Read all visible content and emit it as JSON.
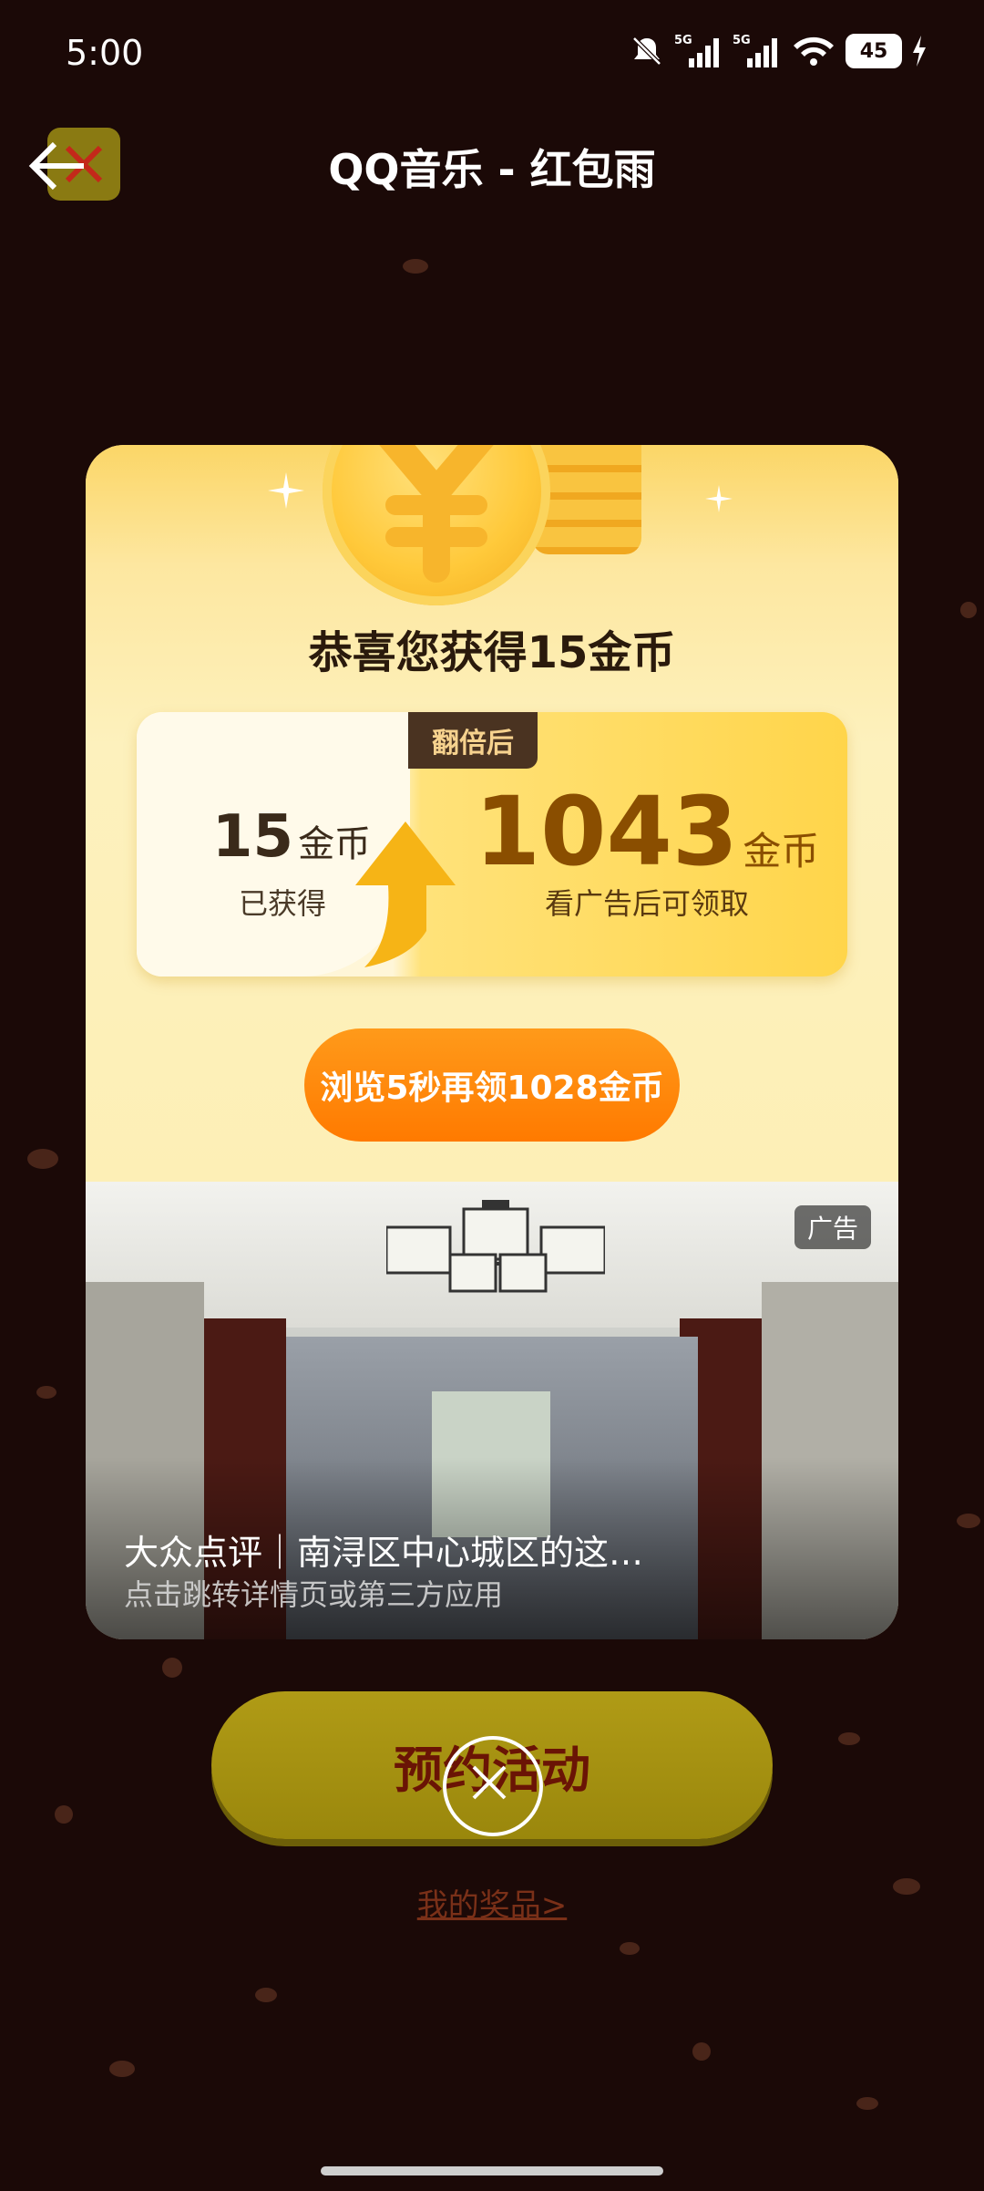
{
  "status_bar": {
    "time": "5:00",
    "battery": "45"
  },
  "header": {
    "title": "QQ音乐 - 红包雨"
  },
  "card": {
    "congrats": "恭喜您获得15金币",
    "badge": "翻倍后",
    "earned": {
      "amount": "15",
      "unit": "金币",
      "label": "已获得"
    },
    "doubled": {
      "amount": "1043",
      "unit": "金币",
      "label": "看广告后可领取"
    },
    "action_button": "浏览5秒再领1028金币"
  },
  "ad": {
    "badge": "广告",
    "title": "大众点评｜南浔区中心城区的这…",
    "subtitle": "点击跳转详情页或第三方应用"
  },
  "bottom": {
    "book_button": "预约活动",
    "prize_link": "我的奖品>"
  }
}
